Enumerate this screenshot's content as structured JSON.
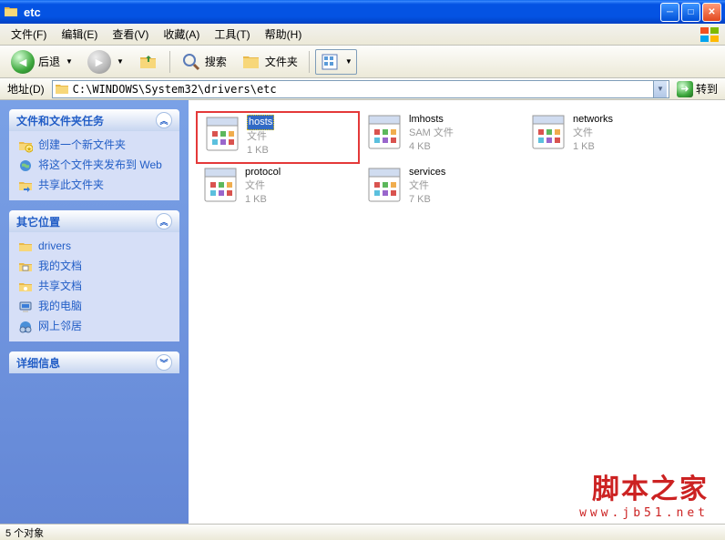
{
  "window": {
    "title": "etc"
  },
  "menu": {
    "file": "文件(F)",
    "edit": "编辑(E)",
    "view": "查看(V)",
    "favorites": "收藏(A)",
    "tools": "工具(T)",
    "help": "帮助(H)"
  },
  "toolbar": {
    "back": "后退",
    "search": "搜索",
    "folders": "文件夹"
  },
  "address": {
    "label": "地址(D)",
    "path": "C:\\WINDOWS\\System32\\drivers\\etc",
    "go": "转到"
  },
  "sidebar": {
    "tasks": {
      "title": "文件和文件夹任务",
      "items": [
        {
          "icon": "new-folder-icon",
          "label": "创建一个新文件夹"
        },
        {
          "icon": "publish-icon",
          "label": "将这个文件夹发布到 Web"
        },
        {
          "icon": "share-icon",
          "label": "共享此文件夹"
        }
      ]
    },
    "places": {
      "title": "其它位置",
      "items": [
        {
          "icon": "folder-icon",
          "label": "drivers"
        },
        {
          "icon": "documents-icon",
          "label": "我的文档"
        },
        {
          "icon": "shared-docs-icon",
          "label": "共享文档"
        },
        {
          "icon": "computer-icon",
          "label": "我的电脑"
        },
        {
          "icon": "network-icon",
          "label": "网上邻居"
        }
      ]
    },
    "details": {
      "title": "详细信息"
    }
  },
  "files": [
    {
      "name": "hosts",
      "type": "文件",
      "size": "1 KB",
      "selected": true,
      "highlighted": true
    },
    {
      "name": "lmhosts",
      "type": "SAM 文件",
      "size": "4 KB",
      "selected": false,
      "highlighted": false
    },
    {
      "name": "networks",
      "type": "文件",
      "size": "1 KB",
      "selected": false,
      "highlighted": false
    },
    {
      "name": "protocol",
      "type": "文件",
      "size": "1 KB",
      "selected": false,
      "highlighted": false
    },
    {
      "name": "services",
      "type": "文件",
      "size": "7 KB",
      "selected": false,
      "highlighted": false
    }
  ],
  "status": {
    "text": "5 个对象"
  },
  "watermark": {
    "main": "脚本之家",
    "sub": "www.jb51.net"
  }
}
